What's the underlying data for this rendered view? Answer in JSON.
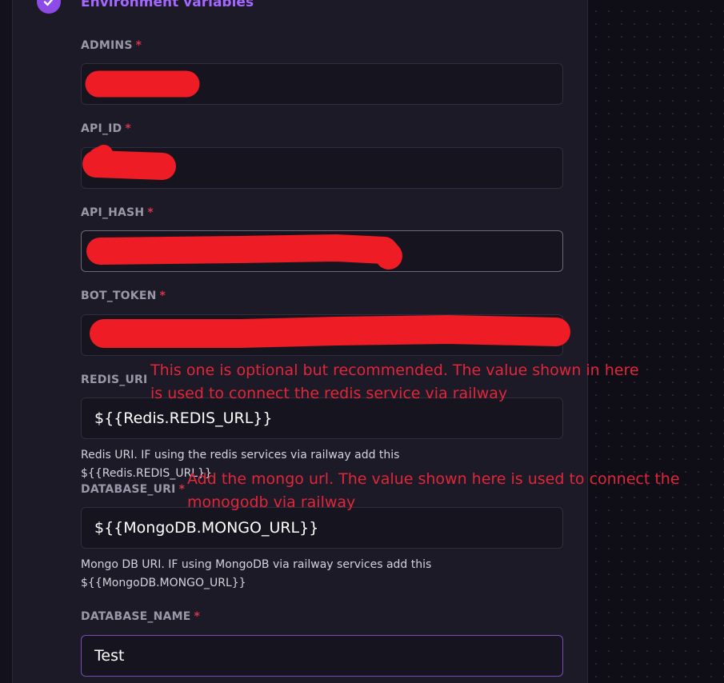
{
  "section": {
    "title": "Environment variables"
  },
  "fields": [
    {
      "label": "ADMINS",
      "required": "*",
      "value": ""
    },
    {
      "label": "API_ID",
      "required": "*",
      "value": ""
    },
    {
      "label": "API_HASH",
      "required": "*",
      "value": ""
    },
    {
      "label": "BOT_TOKEN",
      "required": "*",
      "value": ""
    },
    {
      "label": "REDIS_URI",
      "value": "${{Redis.REDIS_URL}}",
      "help": "Redis URI. IF using the redis services via railway add this ${{Redis.REDIS_URL}}"
    },
    {
      "label": "DATABASE_URI",
      "required": "*",
      "value": "${{MongoDB.MONGO_URL}}",
      "help": "Mongo DB URI. IF using MongoDB via railway services add this ${{MongoDB.MONGO_URL}}"
    },
    {
      "label": "DATABASE_NAME",
      "required": "*",
      "value": "Test"
    }
  ],
  "annotations": {
    "redis": [
      "This one is optional but recommended. The value shown in here",
      "is used to connect the redis service via railway"
    ],
    "mongo": [
      "Add the mongo url. The value shown here is used to connect the",
      "monogodb via railway"
    ]
  },
  "colors": {
    "accent": "#a467ff",
    "required": "#d8344a",
    "redaction": "#ee1c25",
    "annotation": "#e2263a"
  },
  "icons": {
    "section_status": "check-circle-icon"
  }
}
